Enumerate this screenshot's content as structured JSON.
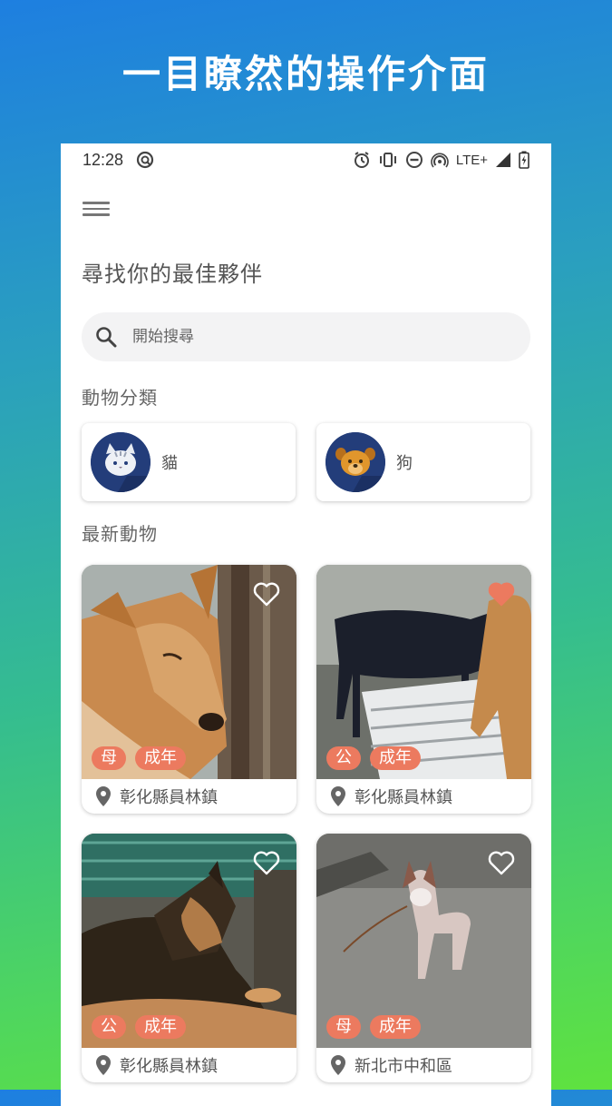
{
  "headline": "一目瞭然的操作介面",
  "status_bar": {
    "time": "12:28",
    "network": "LTE+"
  },
  "page_title": "尋找你的最佳夥伴",
  "search": {
    "placeholder": "開始搜尋"
  },
  "categories": {
    "title": "動物分類",
    "items": [
      {
        "label": "貓",
        "icon": "cat-face-icon"
      },
      {
        "label": "狗",
        "icon": "dog-face-icon"
      }
    ]
  },
  "latest": {
    "title": "最新動物",
    "pets": [
      {
        "sex": "母",
        "age": "成年",
        "location": "彰化縣員林鎮",
        "favorited": false
      },
      {
        "sex": "公",
        "age": "成年",
        "location": "彰化縣員林鎮",
        "favorited": true
      },
      {
        "sex": "公",
        "age": "成年",
        "location": "彰化縣員林鎮",
        "favorited": false
      },
      {
        "sex": "母",
        "age": "成年",
        "location": "新北市中和區",
        "favorited": false
      }
    ]
  },
  "colors": {
    "tag": "#ec7a5f",
    "heart_active": "#ec7a5f",
    "avatar_bg": "#233d7a"
  }
}
